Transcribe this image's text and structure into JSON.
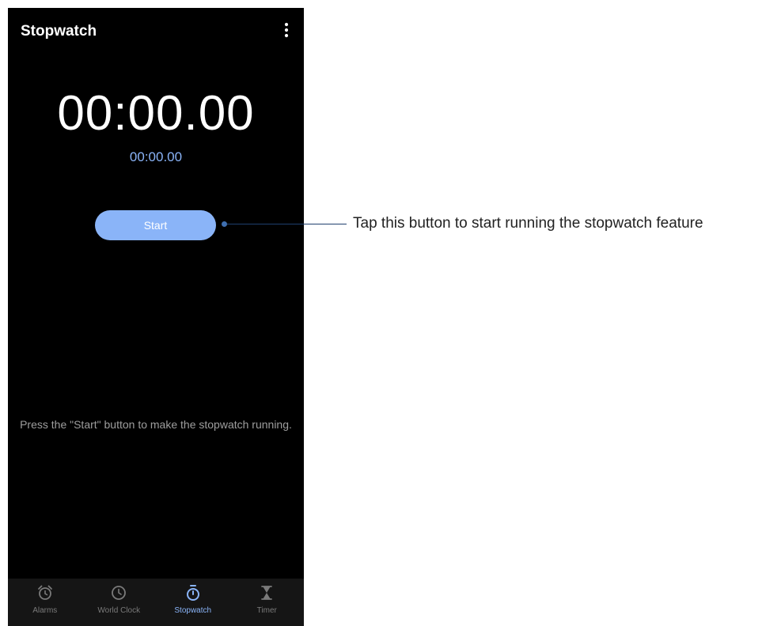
{
  "app": {
    "title": "Stopwatch",
    "menu_icon": "more-vertical-icon"
  },
  "stopwatch": {
    "main_time": "00:00.00",
    "lap_time": "00:00.00",
    "start_label": "Start",
    "hint": "Press the \"Start\" button to make the stopwatch running."
  },
  "nav": {
    "items": [
      {
        "label": "Alarms",
        "icon": "alarm-clock-icon",
        "active": false
      },
      {
        "label": "World Clock",
        "icon": "clock-icon",
        "active": false
      },
      {
        "label": "Stopwatch",
        "icon": "stopwatch-icon",
        "active": true
      },
      {
        "label": "Timer",
        "icon": "hourglass-icon",
        "active": false
      }
    ]
  },
  "callout": {
    "text": "Tap this button to start running the stopwatch feature"
  },
  "colors": {
    "accent": "#8ab4f8",
    "background": "#000000",
    "nav_background": "#151515",
    "inactive": "#7a7a7a"
  }
}
